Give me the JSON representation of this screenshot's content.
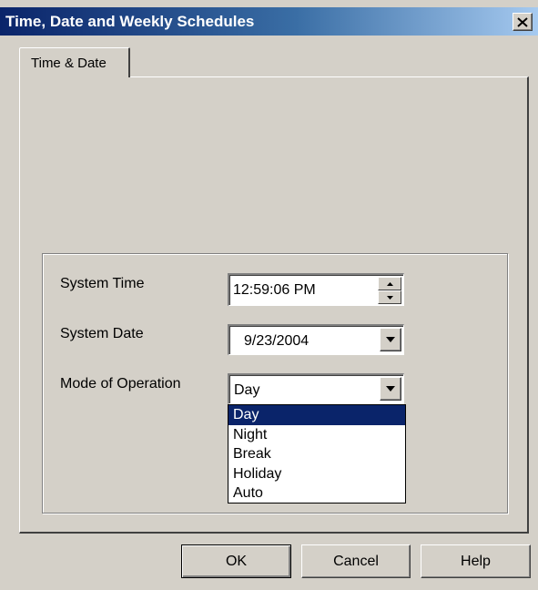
{
  "window": {
    "title": "Time, Date and Weekly Schedules",
    "close_glyph": "✕"
  },
  "tabs": [
    {
      "label": "Time & Date",
      "active": true
    }
  ],
  "system_time": {
    "label": "System Time",
    "value": "12:59:06 PM"
  },
  "system_date": {
    "label": "System Date",
    "value": "9/23/2004"
  },
  "mode": {
    "label": "Mode of Operation",
    "value": "Day",
    "options": [
      "Day",
      "Night",
      "Break",
      "Holiday",
      "Auto"
    ],
    "highlighted": "Day"
  },
  "buttons": {
    "ok": "OK",
    "cancel": "Cancel",
    "help": "Help"
  },
  "icons": {
    "spin_up": "spin-up-icon",
    "spin_down": "spin-down-icon",
    "dropdown": "chevron-down-icon",
    "close": "close-icon"
  },
  "colors": {
    "title_bar_start": "#0a246a",
    "title_bar_end": "#a6caf0",
    "selection": "#0a246a",
    "face": "#d4d0c8"
  }
}
